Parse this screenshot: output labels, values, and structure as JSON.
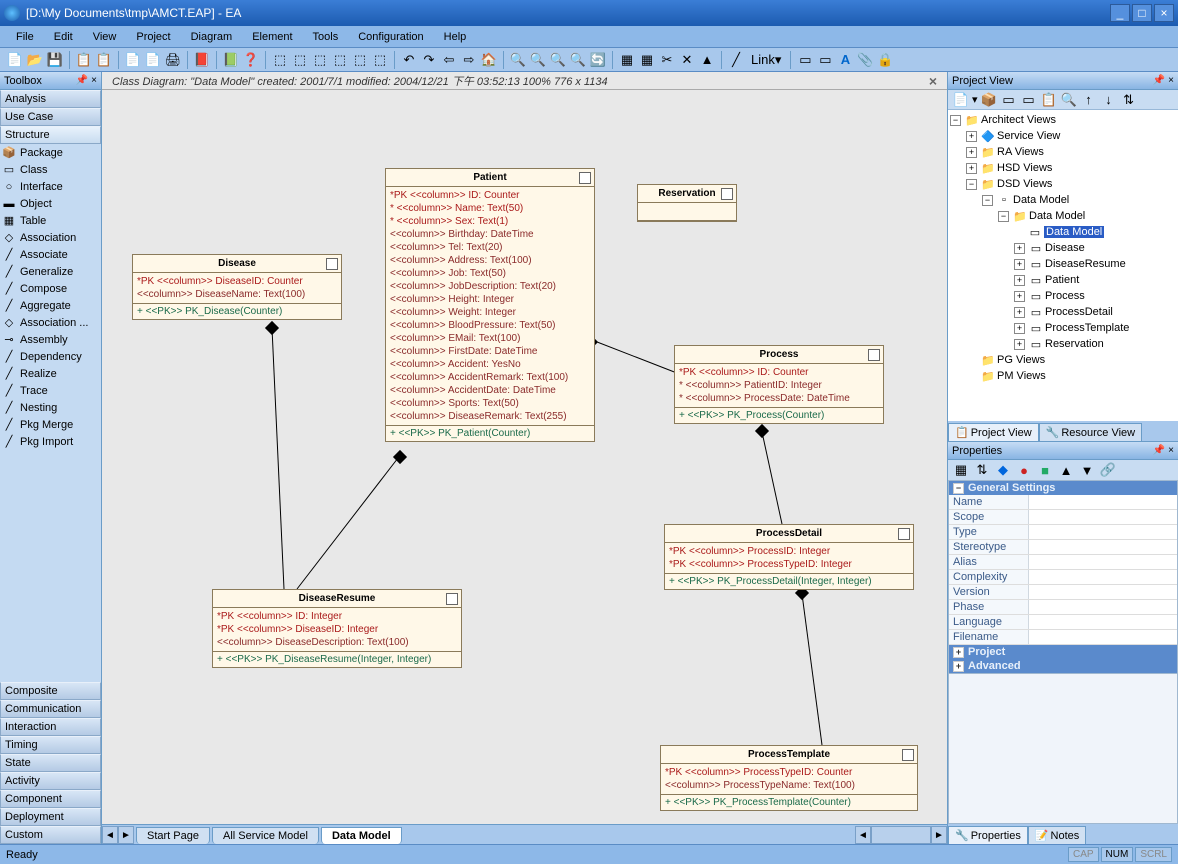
{
  "window": {
    "title": "[D:\\My Documents\\tmp\\AMCT.EAP] - EA",
    "min": "_",
    "max": "□",
    "close": "×"
  },
  "menu": [
    "File",
    "Edit",
    "View",
    "Project",
    "Diagram",
    "Element",
    "Tools",
    "Configuration",
    "Help"
  ],
  "toolbox": {
    "title": "Toolbox",
    "cats_top": [
      "Analysis",
      "Use Case",
      "Structure"
    ],
    "items": [
      "Package",
      "Class",
      "Interface",
      "Object",
      "Table",
      "Association",
      "Associate",
      "Generalize",
      "Compose",
      "Aggregate",
      "Association ...",
      "Assembly",
      "Dependency",
      "Realize",
      "Trace",
      "Nesting",
      "Pkg Merge",
      "Pkg Import"
    ],
    "cats_bottom": [
      "Composite",
      "Communication",
      "Interaction",
      "Timing",
      "State",
      "Activity",
      "Component",
      "Deployment",
      "Custom"
    ]
  },
  "canvas": {
    "info": "Class Diagram: \"Data Model\"    created: 2001/7/1   modified: 2004/12/21 下午 03:52:13    100%    776 x 1134",
    "tabs": [
      "Start Page",
      "All Service Model",
      "Data Model"
    ],
    "active_tab": 2
  },
  "classes": {
    "disease": {
      "name": "Disease",
      "attrs": [
        "*PK  <<column>> DiseaseID:  Counter",
        "        <<column>> DiseaseName:  Text(100)"
      ],
      "ops": "+    <<PK>> PK_Disease(Counter)"
    },
    "patient": {
      "name": "Patient",
      "attrs": [
        "*PK  <<column>> ID:  Counter",
        "*      <<column>> Name:  Text(50)",
        "*      <<column>> Sex:  Text(1)",
        "        <<column>> Birthday:  DateTime",
        "        <<column>> Tel:  Text(20)",
        "        <<column>> Address:  Text(100)",
        "        <<column>> Job:  Text(50)",
        "        <<column>> JobDescription:  Text(20)",
        "        <<column>> Height:  Integer",
        "        <<column>> Weight:  Integer",
        "        <<column>> BloodPressure:  Text(50)",
        "        <<column>> EMail:  Text(100)",
        "        <<column>> FirstDate:  DateTime",
        "        <<column>> Accident:  YesNo",
        "        <<column>> AccidentRemark:  Text(100)",
        "        <<column>> AccidentDate:  DateTime",
        "        <<column>> Sports:  Text(50)",
        "        <<column>> DiseaseRemark:  Text(255)"
      ],
      "ops": "+    <<PK>> PK_Patient(Counter)"
    },
    "reservation": {
      "name": "Reservation"
    },
    "process": {
      "name": "Process",
      "attrs": [
        "*PK  <<column>> ID:  Counter",
        "*      <<column>> PatientID:  Integer",
        "*      <<column>> ProcessDate:  DateTime"
      ],
      "ops": "+    <<PK>> PK_Process(Counter)"
    },
    "diseaseresume": {
      "name": "DiseaseResume",
      "attrs": [
        "*PK  <<column>> ID:  Integer",
        "*PK  <<column>> DiseaseID:  Integer",
        "        <<column>> DiseaseDescription:  Text(100)"
      ],
      "ops": "+    <<PK>> PK_DiseaseResume(Integer, Integer)"
    },
    "processdetail": {
      "name": "ProcessDetail",
      "attrs": [
        "*PK  <<column>> ProcessID:  Integer",
        "*PK  <<column>> ProcessTypeID:  Integer"
      ],
      "ops": "+    <<PK>> PK_ProcessDetail(Integer, Integer)"
    },
    "processtemplate": {
      "name": "ProcessTemplate",
      "attrs": [
        "*PK  <<column>> ProcessTypeID:  Counter",
        "        <<column>> ProcessTypeName:  Text(100)"
      ],
      "ops": "+    <<PK>> PK_ProcessTemplate(Counter)"
    }
  },
  "project_view": {
    "title": "Project View",
    "tabs": [
      "Project View",
      "Resource View"
    ],
    "tree": {
      "root": "Architect Views",
      "service": "Service View",
      "ra": "RA Views",
      "hsd": "HSD Views",
      "dsd": "DSD Views",
      "dm_pkg": "Data Model",
      "dm_pkg2": "Data Model",
      "dm_diag": "Data Model",
      "entities": [
        "Disease",
        "DiseaseResume",
        "Patient",
        "Process",
        "ProcessDetail",
        "ProcessTemplate",
        "Reservation"
      ],
      "pg": "PG Views",
      "pm": "PM Views"
    }
  },
  "properties": {
    "title": "Properties",
    "sections": {
      "general": "General Settings",
      "project": "Project",
      "advanced": "Advanced"
    },
    "keys": [
      "Name",
      "Scope",
      "Type",
      "Stereotype",
      "Alias",
      "Complexity",
      "Version",
      "Phase",
      "Language",
      "Filename"
    ],
    "tabs": [
      "Properties",
      "Notes"
    ]
  },
  "statusbar": {
    "ready": "Ready",
    "cap": "CAP",
    "num": "NUM",
    "scrl": "SCRL"
  },
  "link_label": "Link"
}
